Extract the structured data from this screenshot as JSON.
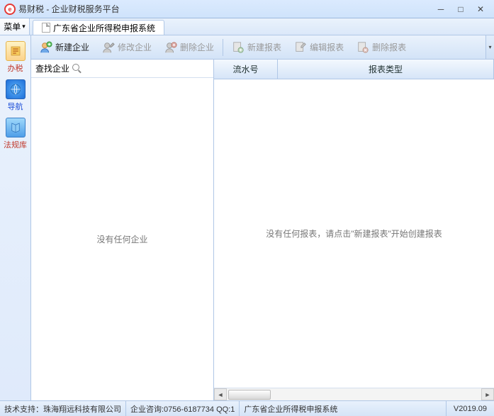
{
  "app": {
    "title": "易财税 - 企业财税服务平台"
  },
  "menu": {
    "label": "菜单"
  },
  "tab": {
    "label": "广东省企业所得税申报系统"
  },
  "sidebar": {
    "items": [
      {
        "label": "办税"
      },
      {
        "label": "导航"
      },
      {
        "label": "法规库"
      }
    ]
  },
  "toolbar": {
    "new_enterprise": "新建企业",
    "edit_enterprise": "修改企业",
    "delete_enterprise": "删除企业",
    "new_report": "新建报表",
    "edit_report": "编辑报表",
    "delete_report": "删除报表"
  },
  "search": {
    "label": "查找企业",
    "value": ""
  },
  "left_empty": "没有任何企业",
  "grid": {
    "col1": "流水号",
    "col2": "报表类型",
    "empty": "没有任何报表，请点击\"新建报表\"开始创建报表"
  },
  "status": {
    "support": "技术支持：珠海翔远科技有限公司",
    "consult": "企业咨询:0756-6187734 QQ:1",
    "context": "广东省企业所得税申报系统",
    "version": "V2019.09"
  }
}
